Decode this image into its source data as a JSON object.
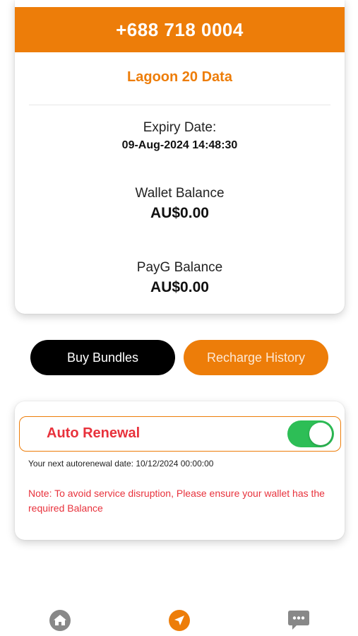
{
  "account": {
    "phone_number": "+688 718 0004",
    "plan_name": "Lagoon 20 Data",
    "expiry_label": "Expiry Date:",
    "expiry_value": "09-Aug-2024 14:48:30",
    "wallet_label": "Wallet Balance",
    "wallet_value": "AU$0.00",
    "payg_label": "PayG Balance",
    "payg_value": "AU$0.00"
  },
  "actions": {
    "buy_bundles_label": "Buy Bundles",
    "recharge_history_label": "Recharge History"
  },
  "auto_renewal": {
    "label": "Auto Renewal",
    "enabled": true,
    "next_date_text": "Your next autorenewal date: 10/12/2024 00:00:00",
    "note_text": "Note: To avoid service disruption, Please ensure your wallet has the required Balance"
  },
  "bottom_nav": {
    "items": [
      {
        "icon": "home-icon",
        "active": false
      },
      {
        "icon": "send-icon",
        "active": true
      },
      {
        "icon": "chat-icon",
        "active": false
      }
    ]
  },
  "colors": {
    "accent": "#ED7D09",
    "toggle_on": "#2DBE56",
    "warning": "#E8323C",
    "nav_inactive": "#888888"
  }
}
